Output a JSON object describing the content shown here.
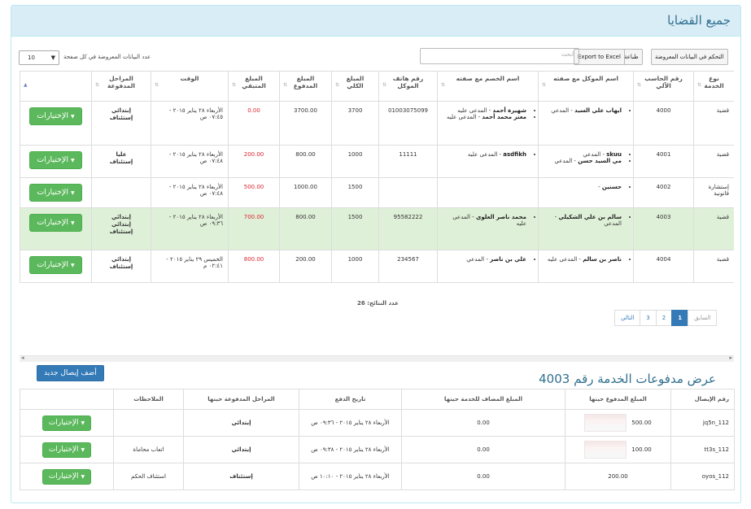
{
  "page": {
    "title": "جميع القضايا"
  },
  "toolbar": {
    "control_label": "التحكم في البيانات المعروضة",
    "print_label": "طباعة",
    "export_label": "Export to Excel",
    "search_placeholder": "ابحث",
    "length_value": "10",
    "length_label": "عدد البيانات المعروضة في كل صفحة"
  },
  "cases": {
    "headers": [
      "نوع الخدمة",
      "رقم الحاسب الآلي",
      "اسم الموكل مع صفته",
      "اسم الخصم مع صفته",
      "رقم هاتف الموكل",
      "المبلغ الكلي",
      "المبلغ المدفوع",
      "المبلغ المتبقي",
      "الوقت",
      "المراحل المدفوعة",
      ""
    ],
    "action_label": "الإختيارات",
    "rows": [
      {
        "type": "قضية",
        "id": "4000",
        "clients": [
          {
            "name": "ايهاب علي السيد",
            "role": " - المدعي"
          }
        ],
        "opponents": [
          {
            "name": "شهيرة أحمد",
            "role": " - المدعى عليه"
          },
          {
            "name": "معتز محمد أحمد",
            "role": " - المدعى عليه"
          }
        ],
        "phone": "01003075099",
        "total": "3700",
        "paid": "3700.00",
        "remaining": "0.00",
        "time": "الأربعاء ٢٨ يناير ٢٠١٥ - ٠٧:٤٥ ص",
        "stages": [
          "إبتدائي",
          "إستئناف"
        ]
      },
      {
        "type": "قضية",
        "id": "4001",
        "clients": [
          {
            "name": "skuu",
            "role": " - المدعي"
          },
          {
            "name": "مي السيد حسن",
            "role": " - المدعي"
          }
        ],
        "opponents": [
          {
            "name": "asdfikh",
            "role": " - المدعى عليه"
          }
        ],
        "phone": "11111",
        "total": "1000",
        "paid": "800.00",
        "remaining": "200.00",
        "time": "الأربعاء ٢٨ يناير ٢٠١٥ - ٠٧:٤٨ ص",
        "stages": [
          "عليا",
          "إستئناف"
        ]
      },
      {
        "type": "إستشارة قانونية",
        "id": "4002",
        "clients": [
          {
            "name": "حسنين",
            "role": " -"
          }
        ],
        "opponents": [],
        "phone": "",
        "total": "1500",
        "paid": "1000.00",
        "remaining": "500.00",
        "time": "الأربعاء ٢٨ يناير ٢٠١٥ - ٠٧:٤٨ ص",
        "stages": []
      },
      {
        "type": "قضية",
        "id": "4003",
        "clients": [
          {
            "name": "سالم بن علي الشكيلي",
            "role": " - المدعي"
          }
        ],
        "opponents": [
          {
            "name": "محمد ناصر العلوي",
            "role": " - المدعى عليه"
          }
        ],
        "phone": "95582222",
        "total": "1500",
        "paid": "800.00",
        "remaining": "700.00",
        "time": "الأربعاء ٢٨ يناير ٢٠١٥ - ٠٩:٣٦ ص",
        "stages": [
          "إبتدائي",
          "إبتدائي",
          "إستئناف"
        ]
      },
      {
        "type": "قضية",
        "id": "4004",
        "clients": [
          {
            "name": "ناصر بن سالم",
            "role": " - المدعى عليه"
          }
        ],
        "opponents": [
          {
            "name": "علي بن ناصر",
            "role": " - المدعي"
          }
        ],
        "phone": "234567",
        "total": "1000",
        "paid": "200.00",
        "remaining": "800.00",
        "time": "الخميس ٢٩ يناير ٢٠١٥ - ٠٢:٤١ م",
        "stages": [
          "إبتدائي",
          "إستئناف"
        ]
      }
    ],
    "results_label": "عدد النتائج: 26"
  },
  "pagination": {
    "next": "التالي",
    "pages": [
      "3",
      "2",
      "1"
    ],
    "prev": "السابق"
  },
  "payments": {
    "title": "عرض مدفوعات الخدمة رقم 4003",
    "add_label": "أضف إيصال جديد",
    "headers": [
      "رقم الإيصال",
      "المبلغ المدفوع حينها",
      "المبلغ المضاف للخدمة حينها",
      "تاريخ الدفع",
      "المراحل المدفوعة حينها",
      "الملاحظات",
      ""
    ],
    "action_label": "الإختيارات",
    "rows": [
      {
        "receipt": "112_jq5n",
        "paid": "500.00",
        "added": "0.00",
        "date": "الأربعاء ٢٨ يناير ٢٠١٥ - ٠٩:٣٦ ص",
        "stages": "إبتدائي",
        "notes": ""
      },
      {
        "receipt": "112_tt3s",
        "paid": "100.00",
        "added": "0.00",
        "date": "الأربعاء ٢٨ يناير ٢٠١٥ - ٠٩:٣٨ ص",
        "stages": "إبتدائي",
        "notes": "اتعاب محاماة"
      },
      {
        "receipt": "112_oyos",
        "paid": "200.00",
        "added": "0.00",
        "date": "الأربعاء ٢٨ يناير ٢٠١٥ - ١٠:١٠ ص",
        "stages": "إستئناف",
        "notes": "استئناف الحكم"
      }
    ]
  }
}
